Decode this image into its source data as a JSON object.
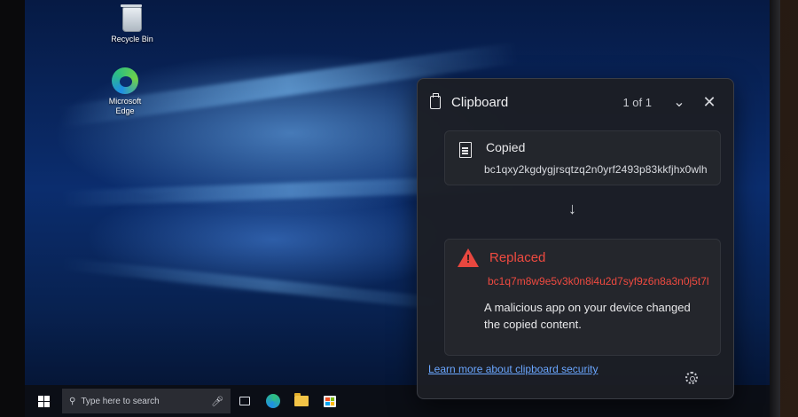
{
  "desktop": {
    "icons": [
      {
        "label": "Recycle Bin",
        "icon": "recycle-bin-icon"
      },
      {
        "label": "Microsoft\nEdge",
        "icon": "edge-icon"
      }
    ]
  },
  "taskbar": {
    "search_placeholder": "Type here to search",
    "icons": [
      "windows-start-icon",
      "search-icon",
      "microphone-icon",
      "task-view-icon",
      "edge-icon",
      "file-explorer-icon",
      "store-icon"
    ]
  },
  "clipboard": {
    "title": "Clipboard",
    "counter": "1 of 1",
    "copied": {
      "title": "Copied",
      "value": "bc1qxy2kgdygjrsqtzq2n0yrf2493p83kkfjhx0wlh"
    },
    "replaced": {
      "title": "Replaced",
      "value": "bc1q7m8w9e5v3k0n8i4u2d7syf9z6n8a3n0j5t7l",
      "message": "A malicious app on your device changed the copied content."
    },
    "learn_more": "Learn more about clipboard security",
    "colors": {
      "warning": "#ef4a40",
      "link": "#6aa6ff",
      "panel_bg": "#1c1e24"
    }
  }
}
